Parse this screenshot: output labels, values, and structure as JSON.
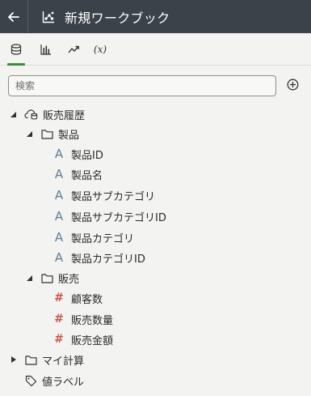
{
  "header": {
    "back_icon": "back-arrow-icon",
    "workbook_icon": "workbook-icon",
    "title": "新規ワークブック",
    "background": "#3b4249"
  },
  "tabs": [
    {
      "name": "data",
      "icon": "database-icon",
      "active": true
    },
    {
      "name": "visualizations",
      "icon": "bar-chart-icon",
      "active": false
    },
    {
      "name": "analytics",
      "icon": "trend-icon",
      "active": false
    },
    {
      "name": "calculations",
      "icon": "function-icon",
      "label": "(x)",
      "active": false
    }
  ],
  "search": {
    "placeholder": "検索",
    "value": ""
  },
  "add_button": {
    "icon": "add-circle-icon"
  },
  "tree": {
    "root": {
      "label": "販売履歴",
      "icon": "cloud-db-icon",
      "expanded": true
    },
    "product_folder": {
      "label": "製品",
      "icon": "folder-icon",
      "expanded": true
    },
    "product_items": [
      {
        "label": "製品ID",
        "type": "text"
      },
      {
        "label": "製品名",
        "type": "text"
      },
      {
        "label": "製品サブカテゴリ",
        "type": "text"
      },
      {
        "label": "製品サブカテゴリID",
        "type": "text"
      },
      {
        "label": "製品カテゴリ",
        "type": "text"
      },
      {
        "label": "製品カテゴリID",
        "type": "text"
      }
    ],
    "sales_folder": {
      "label": "販売",
      "icon": "folder-icon",
      "expanded": true
    },
    "sales_items": [
      {
        "label": "顧客数",
        "type": "number"
      },
      {
        "label": "販売数量",
        "type": "number"
      },
      {
        "label": "販売金額",
        "type": "number"
      }
    ],
    "my_calc": {
      "label": "マイ計算",
      "icon": "folder-icon",
      "expanded": false
    },
    "value_labels": {
      "label": "値ラベル",
      "icon": "tag-icon"
    }
  },
  "colors": {
    "accent": "#3b8f35",
    "attribute_icon": "#5c7e98",
    "measure_icon": "#c9554b"
  }
}
